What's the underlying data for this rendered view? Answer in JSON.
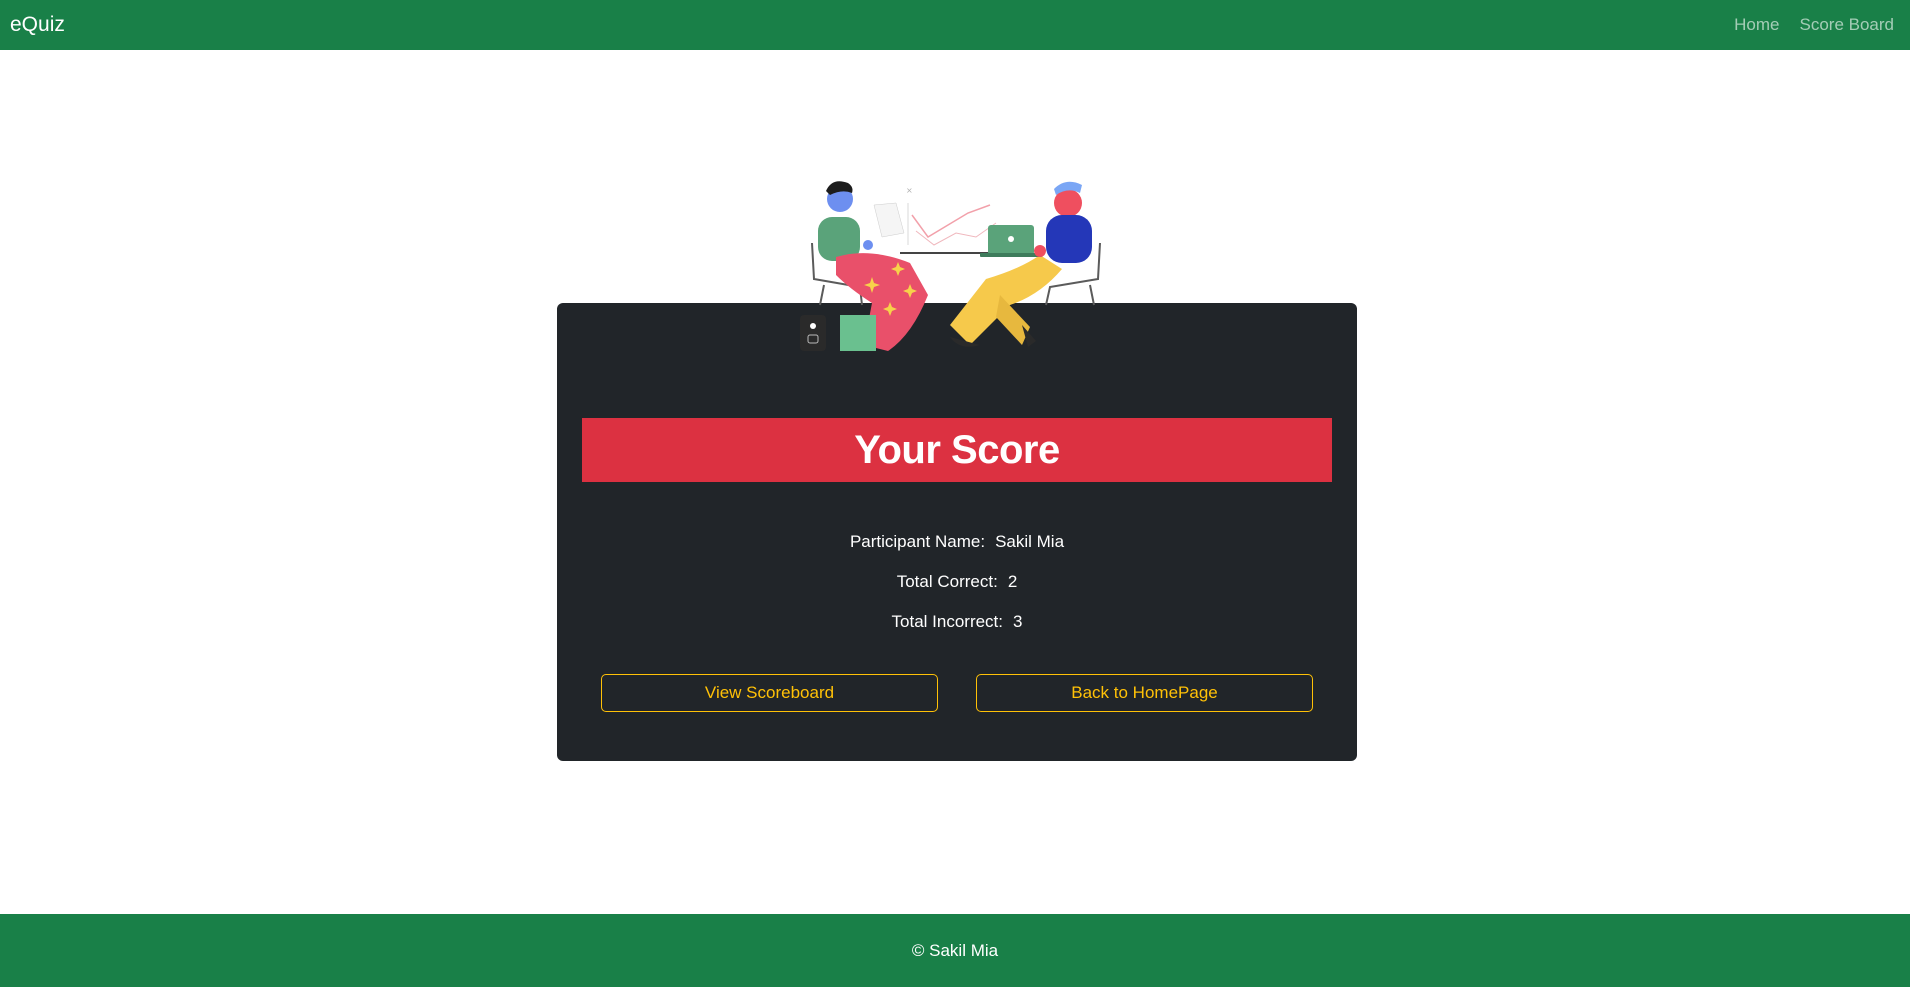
{
  "navbar": {
    "brand": "eQuiz",
    "links": [
      "Home",
      "Score Board"
    ],
    "color": "#198048"
  },
  "illustration": {
    "icon": "two-people-working-illustration"
  },
  "result": {
    "title": "Your Score",
    "participant_label": "Participant Name:",
    "participant_name": "Sakil Mia",
    "correct_label": "Total Correct:",
    "correct_value": "2",
    "incorrect_label": "Total Incorrect:",
    "incorrect_value": "3",
    "banner_color": "#dc3141"
  },
  "buttons": {
    "view_scoreboard": "View Scoreboard",
    "back_home": "Back to HomePage",
    "accent_color": "#ffc107"
  },
  "footer": {
    "text": "© Sakil Mia"
  }
}
